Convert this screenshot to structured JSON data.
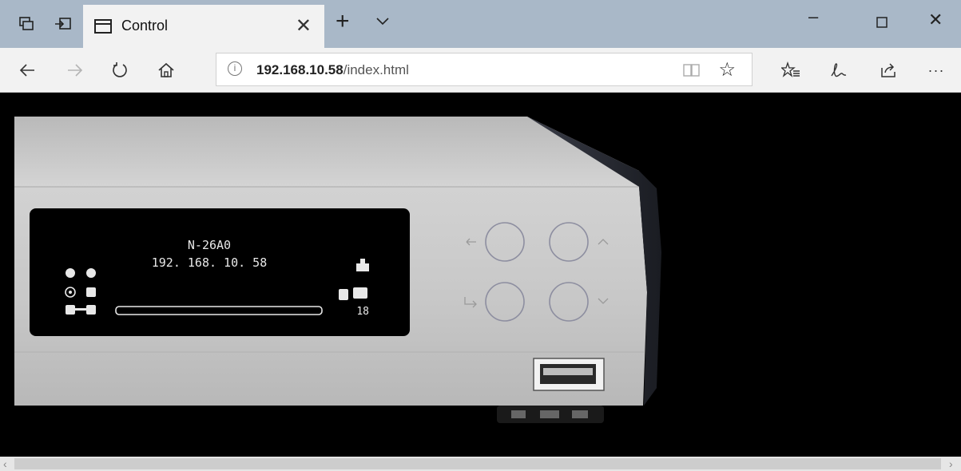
{
  "browser": {
    "tab_title": "Control",
    "url_host": "192.168.10.58",
    "url_path": "/index.html",
    "more_label": "···"
  },
  "device": {
    "model": "N-26A0",
    "ip": "192. 168. 10. 58",
    "number": "18"
  },
  "colors": {
    "titlebar": "#a9b8c8",
    "chrome": "#f2f2f2",
    "device_silver": "#c9c9c9",
    "display": "#000000"
  },
  "icons": {
    "back": "arrow-left-icon",
    "forward": "arrow-right-icon",
    "refresh": "refresh-icon",
    "home": "home-icon",
    "favorite": "star-icon",
    "hub": "favorites-hub-icon",
    "notes": "pen-icon",
    "share": "share-icon"
  }
}
